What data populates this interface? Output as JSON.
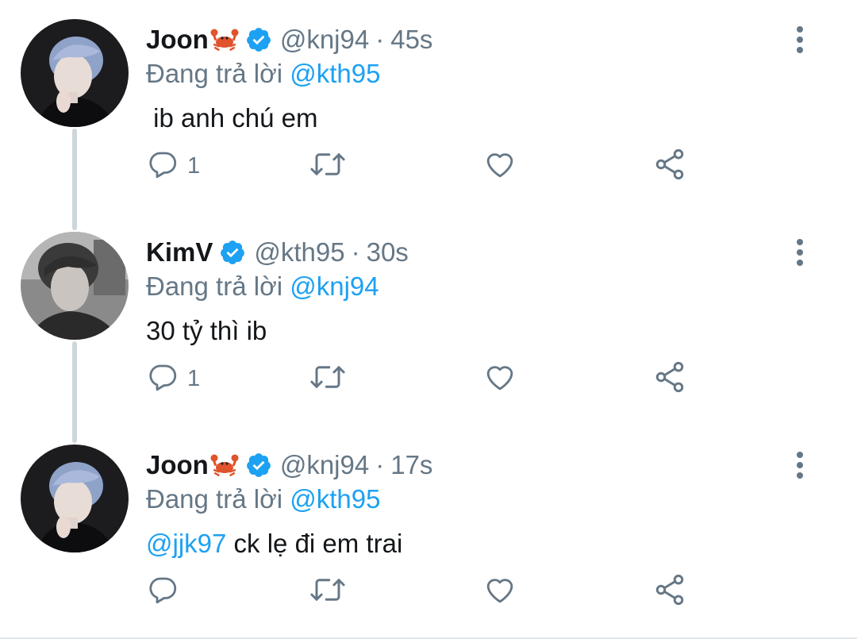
{
  "tweets": [
    {
      "display_name": "Joon",
      "emoji": "crab-emoji",
      "handle": "@knj94",
      "time": "45s",
      "reply_prefix": "Đang trả lời",
      "reply_to": "@kth95",
      "mention": "",
      "text": " ib anh chú em",
      "reply_count": "1",
      "avatar": "joon-avatar"
    },
    {
      "display_name": "KimV",
      "emoji": "",
      "handle": "@kth95",
      "time": "30s",
      "reply_prefix": "Đang trả lời",
      "reply_to": "@knj94",
      "mention": "",
      "text": "30 tỷ thì ib",
      "reply_count": "1",
      "avatar": "kimv-avatar"
    },
    {
      "display_name": "Joon",
      "emoji": "crab-emoji",
      "handle": "@knj94",
      "time": "17s",
      "reply_prefix": "Đang trả lời",
      "reply_to": "@kth95",
      "mention": "@jjk97",
      "text": " ck lẹ đi em trai",
      "reply_count": "",
      "avatar": "joon-avatar"
    }
  ],
  "separator": "·",
  "icons": {
    "verified": "verified-badge-icon",
    "more": "more-options-icon",
    "reply": "reply-icon",
    "retweet": "retweet-icon",
    "like": "like-icon",
    "share": "share-icon"
  },
  "colors": {
    "accent": "#1da1f2",
    "secondary_text": "#657786",
    "primary_text": "#14171a",
    "thread_line": "#ccd6dd"
  }
}
